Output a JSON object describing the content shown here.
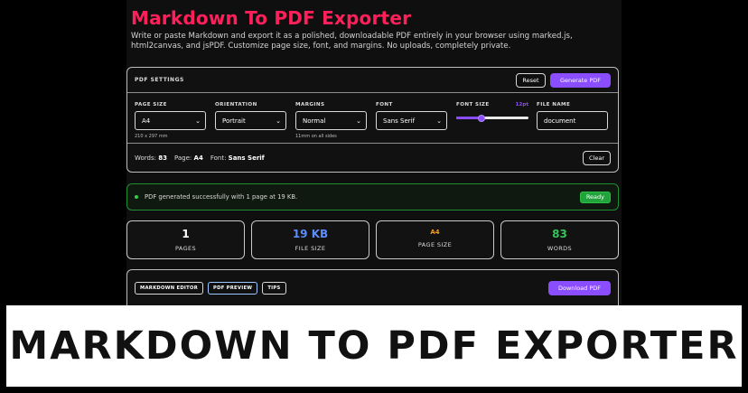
{
  "app": {
    "title": "Markdown To PDF Exporter",
    "description": "Write or paste Markdown and export it as a polished, downloadable PDF entirely in your browser using marked.js, html2canvas, and jsPDF. Customize page size, font, and margins. No uploads, completely private."
  },
  "settings": {
    "heading": "PDF SETTINGS",
    "reset_label": "Reset",
    "generate_label": "Generate PDF",
    "page_size": {
      "label": "PAGE SIZE",
      "value": "A4",
      "hint": "210 x 297 mm"
    },
    "orientation": {
      "label": "ORIENTATION",
      "value": "Portrait"
    },
    "margins": {
      "label": "MARGINS",
      "value": "Normal",
      "hint": "11mm on all sides"
    },
    "font": {
      "label": "FONT",
      "value": "Sans Serif"
    },
    "font_size": {
      "label": "FONT SIZE",
      "value": "12pt",
      "level": 0.35
    },
    "file_name": {
      "label": "FILE NAME",
      "value": "document"
    },
    "footer": {
      "words_label": "Words:",
      "words_value": "83",
      "page_label": "Page:",
      "page_value": "A4",
      "font_label": "Font:",
      "font_value": "Sans Serif",
      "clear_label": "Clear"
    }
  },
  "status": {
    "message": "PDF generated successfully with 1 page at 19 KB.",
    "badge": "Ready",
    "color": "#2fd14c"
  },
  "stats": [
    {
      "value": "1",
      "caption": "PAGES",
      "color": "#ffffff"
    },
    {
      "value": "19 KB",
      "caption": "FILE SIZE",
      "color": "#5b8cff"
    },
    {
      "value": "A4",
      "caption": "PAGE SIZE",
      "color": "#f0a020"
    },
    {
      "value": "83",
      "caption": "WORDS",
      "color": "#39c45a"
    }
  ],
  "tabs": {
    "items": [
      "MARKDOWN EDITOR",
      "PDF PREVIEW",
      "TIPS"
    ],
    "active": "PDF PREVIEW",
    "download_label": "Download PDF"
  },
  "banner": {
    "text": "MARKDOWN TO PDF EXPORTER"
  },
  "colors": {
    "accent": "#8a4dff",
    "title": "#ff1f5a"
  }
}
